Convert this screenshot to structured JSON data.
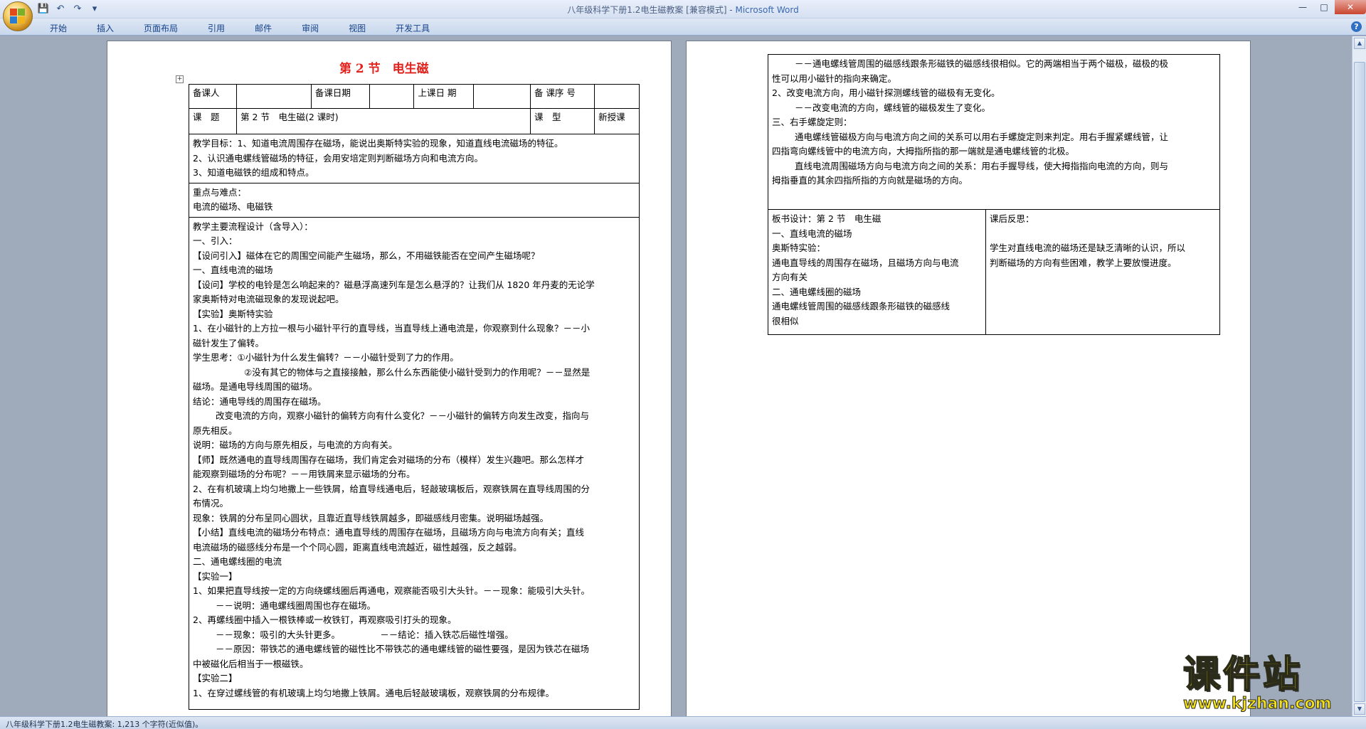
{
  "window": {
    "title": "八年级科学下册1.2电生磁教案 [兼容模式] - ",
    "app_name": "Microsoft Word",
    "minimize": "—",
    "maximize": "□",
    "close": "✕"
  },
  "qat": {
    "save": "💾",
    "undo": "↶",
    "redo": "↷",
    "more": "▾"
  },
  "ribbon": {
    "tabs": [
      "开始",
      "插入",
      "页面布局",
      "引用",
      "邮件",
      "审阅",
      "视图",
      "开发工具"
    ],
    "help": "?"
  },
  "doc": {
    "title": "第 2 节　电生磁",
    "header_row": [
      "备课人",
      "",
      "备课日期",
      "",
      "上课日 期",
      "",
      "备 课序 号",
      ""
    ],
    "title_row": [
      "课　题",
      "第 2 节　电生磁(2 课时)",
      "课　型",
      "新授课"
    ],
    "goals": [
      "教学目标：1、知道电流周围存在磁场，能说出奥斯特实验的现象，知道直线电流磁场的特征。",
      "2、认识通电螺线管磁场的特征，会用安培定则判断磁场方向和电流方向。",
      "3、知道电磁铁的组成和特点。"
    ],
    "key_points": [
      "重点与难点：",
      "电流的磁场、电磁铁"
    ],
    "process": [
      "教学主要流程设计（含导入）：",
      "一、引入：",
      "【设问引入】磁体在它的周围空间能产生磁场，那么，不用磁铁能否在空间产生磁场呢？",
      "一、直线电流的磁场",
      "【设问】学校的电铃是怎么响起来的？磁悬浮高速列车是怎么悬浮的？让我们从 1820 年丹麦的无论学",
      "家奥斯特对电流磁现象的发现说起吧。",
      "【实验】奥斯特实验",
      "1、在小磁针的上方拉一根与小磁针平行的直导线，当直导线上通电流是，你观察到什么现象？－－小",
      "磁针发生了偏转。",
      "学生思考：①小磁针为什么发生偏转？－－小磁针受到了力的作用。",
      "②没有其它的物体与之直接接触，那么什么东西能使小磁针受到力的作用呢？－－显然是",
      "磁场。是通电导线周围的磁场。",
      "结论：通电导线的周围存在磁场。",
      "改变电流的方向，观察小磁针的偏转方向有什么变化？－－小磁针的偏转方向发生改变，指向与",
      "原先相反。",
      "说明：磁场的方向与原先相反，与电流的方向有关。",
      "【师】既然通电的直导线周围存在磁场，我们肯定会对磁场的分布（模样）发生兴趣吧。那么怎样才",
      "能观察到磁场的分布呢？－－用铁屑来显示磁场的分布。",
      "2、在有机玻璃上均匀地撒上一些铁屑，给直导线通电后，轻敲玻璃板后，观察铁屑在直导线周围的分",
      "布情况。",
      "现象：铁屑的分布呈同心圆状，且靠近直导线铁屑越多，即磁感线月密集。说明磁场越强。",
      "【小结】直线电流的磁场分布特点：通电直导线的周围存在磁场，且磁场方向与电流方向有关；直线",
      "电流磁场的磁感线分布是一个个同心圆，距离直线电流越近，磁性越强，反之越弱。",
      "二、通电螺线圈的电流",
      "【实验一】",
      "1、如果把直导线按一定的方向绕螺线圈后再通电，观察能否吸引大头针。－－现象：能吸引大头针。",
      "－－说明：通电螺线圈周围也存在磁场。",
      "2、再螺线圈中插入一根铁棒或一枚铁钉，再观察吸引打头的现象。",
      "－－现象：吸引的大头针更多。　　　　　－－结论：插入铁芯后磁性增强。",
      "－－原因：带铁芯的通电螺线管的磁性比不带铁芯的通电螺线管的磁性要强，是因为铁芯在磁场",
      "中被磁化后相当于一根磁铁。",
      "【实验二】",
      "1、在穿过螺线管的有机玻璃上均匀地撒上铁屑。通电后轻敲玻璃板，观察铁屑的分布规律。"
    ],
    "right_top": [
      "－－通电螺线管周围的磁感线跟条形磁铁的磁感线很相似。它的两端相当于两个磁极，磁极的极",
      "性可以用小磁针的指向来确定。",
      "2、改变电流方向，用小磁针探测螺线管的磁极有无变化。",
      "－－改变电流的方向，螺线管的磁极发生了变化。",
      "三、右手螺旋定则：",
      "通电螺线管磁极方向与电流方向之间的关系可以用右手螺旋定则来判定。用右手握紧螺线管，让",
      "四指弯向螺线管中的电流方向，大拇指所指的那一端就是通电螺线管的北极。",
      "直线电流周围磁场方向与电流方向之间的关系：用右手握导线，使大拇指指向电流的方向，则与",
      "拇指垂直的其余四指所指的方向就是磁场的方向。"
    ],
    "board_design": [
      "板书设计：第 2 节　电生磁",
      "一、直线电流的磁场",
      "奥斯特实验：",
      "通电直导线的周围存在磁场，且磁场方向与电流",
      "方向有关",
      "二、通电螺线圈的磁场",
      "通电螺线管周围的磁感线跟条形磁铁的磁感线",
      "很相似"
    ],
    "reflection": [
      "课后反思：",
      "",
      "学生对直线电流的磁场还是缺乏清晰的认识，所以",
      "判断磁场的方向有些困难，教学上要放慢进度。"
    ]
  },
  "status": {
    "text": "八年级科学下册1.2电生磁教案: 1,213 个字符(近似值)。"
  },
  "watermark": {
    "cn": "课件站",
    "url": "www.kjzhan.com"
  },
  "scrollbar": {
    "up": "▲",
    "down": "▼"
  }
}
